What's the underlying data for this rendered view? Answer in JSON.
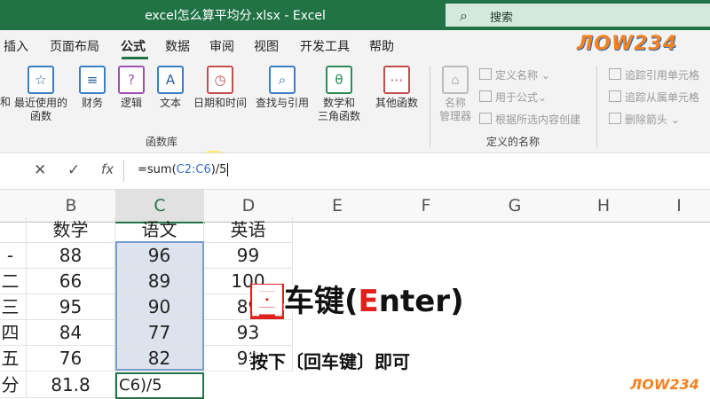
{
  "window": {
    "title": "excel怎么算平均分.xlsx  -  Excel"
  },
  "search": {
    "icon": "search-icon",
    "label": "搜索"
  },
  "menu": {
    "tabs": [
      "插入",
      "页面布局",
      "公式",
      "数据",
      "审阅",
      "视图",
      "开发工具",
      "帮助"
    ],
    "active": "公式"
  },
  "logo": {
    "text": "ЛOW234"
  },
  "ribbon": {
    "function_library": {
      "partial_left": "和",
      "buttons": [
        {
          "icon": "star-icon",
          "label": "最近使用的\n函数"
        },
        {
          "icon": "database-icon",
          "label": "财务"
        },
        {
          "icon": "question-book-icon",
          "label": "逻辑"
        },
        {
          "icon": "text-a-icon",
          "label": "文本"
        },
        {
          "icon": "clock-icon",
          "label": "日期和时间"
        },
        {
          "icon": "search-book-icon",
          "label": "查找与引用"
        },
        {
          "icon": "theta-icon",
          "label": "数学和\n三角函数"
        },
        {
          "icon": "more-functions-icon",
          "label": "其他函数"
        }
      ],
      "group_label": "函数库"
    },
    "defined_names": {
      "name_manager": "名称\n管理器",
      "define_name": "定义名称",
      "use_in_formula": "用于公式",
      "create_from_selection": "根据所选内容创建",
      "group_label": "定义的名称"
    },
    "formula_auditing": {
      "trace_precedents": "追踪引用单元格",
      "trace_dependents": "追踪从属单元格",
      "remove_arrows": "删除箭头"
    }
  },
  "formula_bar": {
    "cancel_icon": "close-icon",
    "enter_icon": "check-icon",
    "fx": "fx",
    "formula_prefix": "=sum(",
    "formula_range": "C2:C6",
    "formula_suffix": ")/5"
  },
  "grid": {
    "columns": [
      "B",
      "C",
      "D",
      "E",
      "F",
      "G",
      "H",
      "I"
    ],
    "selected_column": "C",
    "row_stub": [
      "",
      "-",
      "二",
      "三",
      "四",
      "五",
      "分"
    ],
    "headers": [
      "数学",
      "语文",
      "英语"
    ],
    "rows": [
      [
        "88",
        "96",
        "99"
      ],
      [
        "66",
        "89",
        "100"
      ],
      [
        "95",
        "90",
        "89"
      ],
      [
        "84",
        "77",
        "93"
      ],
      [
        "76",
        "82",
        "98"
      ]
    ],
    "average_row": [
      "81.8",
      "C6)/5",
      ""
    ]
  },
  "captions": {
    "main_first": "回",
    "main_rest_1": "车键(",
    "main_E": "E",
    "main_rest_2": "nter)",
    "sub": "按下〔回车键〕即可"
  },
  "logo_bottom": {
    "text": "ЛOW234"
  },
  "colors": {
    "excel_green": "#217346",
    "selection_fill": "#dce3ec",
    "caption_red": "#e0201b"
  }
}
